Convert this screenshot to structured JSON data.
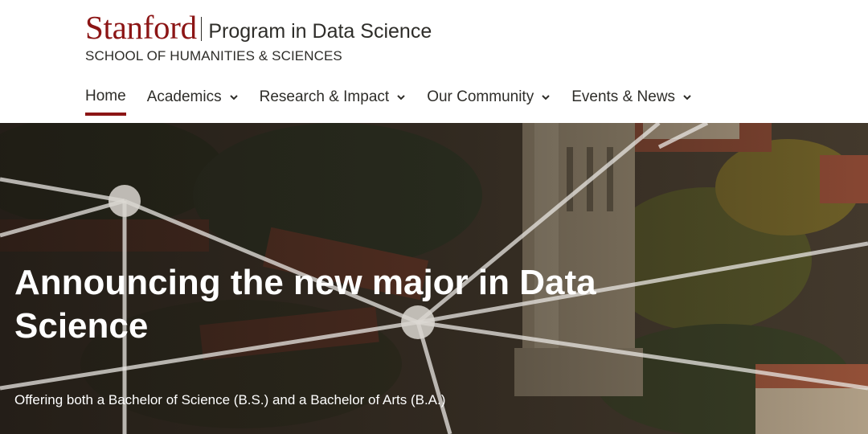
{
  "header": {
    "wordmark": "Stanford",
    "program_name": "Program in Data Science",
    "school_name": "SCHOOL OF HUMANITIES & SCIENCES"
  },
  "nav": {
    "items": [
      {
        "label": "Home",
        "active": true,
        "has_dropdown": false
      },
      {
        "label": "Academics",
        "active": false,
        "has_dropdown": true
      },
      {
        "label": "Research & Impact",
        "active": false,
        "has_dropdown": true
      },
      {
        "label": "Our Community",
        "active": false,
        "has_dropdown": true
      },
      {
        "label": "Events & News",
        "active": false,
        "has_dropdown": true
      }
    ]
  },
  "hero": {
    "title": "Announcing the new major in Data Science",
    "subtitle": "Offering both a Bachelor of Science (B.S.) and a Bachelor of Arts (B.A.)"
  },
  "colors": {
    "brand_red": "#8c1515",
    "text_dark": "#2e2d29",
    "hero_text": "#ffffff"
  }
}
